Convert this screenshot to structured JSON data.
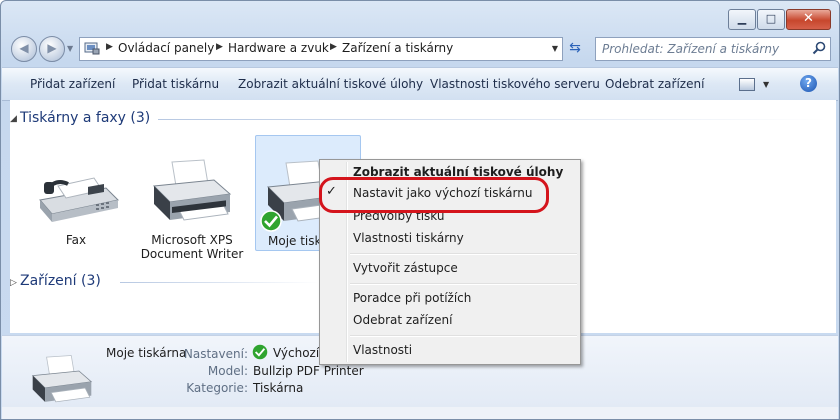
{
  "window": {
    "minimize_label": "▁",
    "maximize_label": "□",
    "close_label": "✕"
  },
  "nav": {
    "back_icon": "◀",
    "forward_icon": "▶",
    "breadcrumbs": [
      "Ovládací panely",
      "Hardware a zvuk",
      "Zařízení a tiskárny"
    ],
    "search_placeholder": "Prohledat: Zařízení a tiskárny"
  },
  "toolbar": {
    "items": [
      "Přidat zařízení",
      "Přidat tiskárnu",
      "Zobrazit aktuální tiskové úlohy",
      "Vlastnosti tiskového serveru",
      "Odebrat zařízení"
    ],
    "help_label": "?"
  },
  "groups": {
    "printers": "Tiskárny a faxy (3)",
    "devices": "Zařízení (3)"
  },
  "devices": [
    {
      "line1": "Fax",
      "line2": ""
    },
    {
      "line1": "Microsoft XPS",
      "line2": "Document Writer"
    },
    {
      "line1": "Moje tisk",
      "line2": ""
    }
  ],
  "context_menu": {
    "items": [
      {
        "label": "Zobrazit aktuální tiskové úlohy",
        "bold": true
      },
      {
        "label": "Nastavit jako výchozí tiskárnu",
        "checked": true
      },
      {
        "label": "Předvolby tisku"
      },
      {
        "label": "Vlastnosti tiskárny"
      },
      {
        "label": "Vytvořit zástupce"
      },
      {
        "label": "Poradce při potížích"
      },
      {
        "label": "Odebrat zařízení"
      },
      {
        "label": "Vlastnosti"
      }
    ],
    "check_glyph": "✓",
    "highlight_color": "#d4141c"
  },
  "details": {
    "name": "Moje tiskárna",
    "rows": [
      {
        "key": "Nastavení:",
        "value": "Výchozí"
      },
      {
        "key": "Model:",
        "value": "Bullzip PDF Printer"
      },
      {
        "key": "Kategorie:",
        "value": "Tiskárna"
      }
    ]
  }
}
